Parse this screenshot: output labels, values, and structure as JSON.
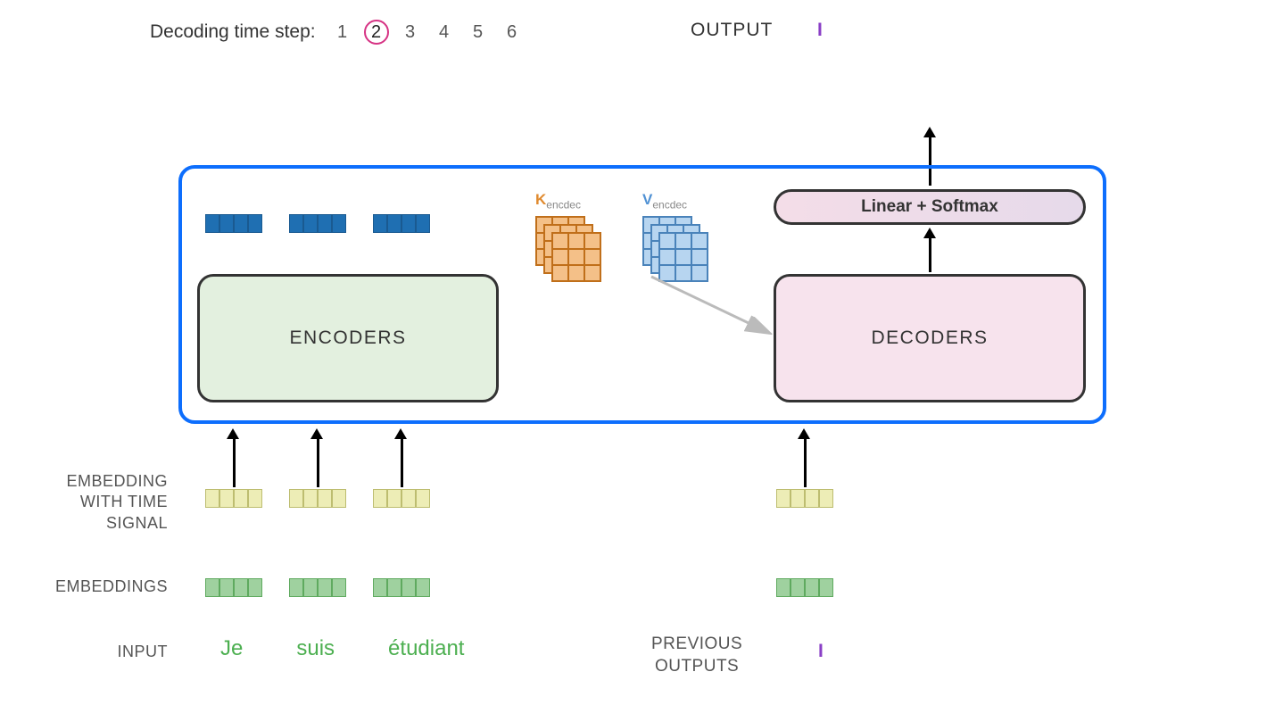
{
  "timestep": {
    "label": "Decoding time step:",
    "steps": [
      "1",
      "2",
      "3",
      "4",
      "5",
      "6"
    ],
    "active_index": 1
  },
  "output": {
    "label": "OUTPUT",
    "token": "I"
  },
  "blocks": {
    "encoders": "ENCODERS",
    "decoders": "DECODERS",
    "linear_softmax": "Linear + Softmax"
  },
  "matrices": {
    "k_label_main": "K",
    "k_label_sub": "encdec",
    "v_label_main": "V",
    "v_label_sub": "encdec"
  },
  "labels": {
    "emb_time_l1": "EMBEDDING",
    "emb_time_l2": "WITH TIME",
    "emb_time_l3": "SIGNAL",
    "embeddings": "EMBEDDINGS",
    "input": "INPUT",
    "prev_out_l1": "PREVIOUS",
    "prev_out_l2": "OUTPUTS"
  },
  "input_tokens": [
    "Je",
    "suis",
    "étudiant"
  ],
  "prev_output_token": "I",
  "colors": {
    "accent_blue": "#0d6efd",
    "active_ring": "#d63384",
    "enc_bg": "#e3f0df",
    "dec_bg": "#f7e3ed",
    "output_purple": "#8a3fc6",
    "input_green": "#4caf50"
  }
}
